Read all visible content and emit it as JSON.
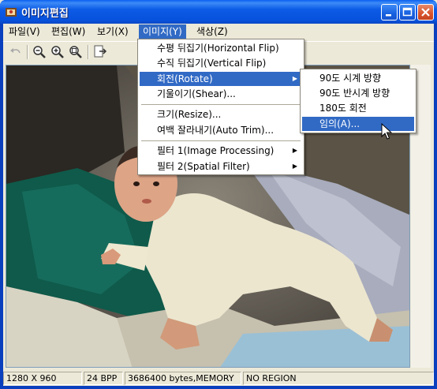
{
  "window": {
    "title": "이미지편집"
  },
  "menubar": [
    {
      "label": "파일(V)"
    },
    {
      "label": "편집(W)"
    },
    {
      "label": "보기(X)"
    },
    {
      "label": "이미지(Y)"
    },
    {
      "label": "색상(Z)"
    }
  ],
  "toolbar": {
    "tools": [
      "undo-icon",
      "zoom-out-icon",
      "zoom-in-icon",
      "zoom-fit-icon",
      "export-icon"
    ]
  },
  "image_menu": [
    {
      "label": "수평 뒤집기(Horizontal Flip)"
    },
    {
      "label": "수직 뒤집기(Vertical Flip)"
    },
    {
      "label": "회전(Rotate)"
    },
    {
      "label": "기울이기(Shear)..."
    },
    {
      "label": "크기(Resize)..."
    },
    {
      "label": "여백 잘라내기(Auto Trim)..."
    },
    {
      "label": "필터 1(Image Processing)"
    },
    {
      "label": "필터 2(Spatial Filter)"
    }
  ],
  "rotate_menu": [
    {
      "label": "90도 시계 방향"
    },
    {
      "label": "90도 반시계 방향"
    },
    {
      "label": "180도 회전"
    },
    {
      "label": "임의(A)..."
    }
  ],
  "statusbar": {
    "dimensions": "1280 X 960",
    "bpp": "24 BPP",
    "memory": "3686400 bytes,MEMORY",
    "region": "NO REGION"
  },
  "colors": {
    "titlebar": "#0a5ff0",
    "highlight": "#316ac5",
    "chrome": "#ece9d8"
  }
}
